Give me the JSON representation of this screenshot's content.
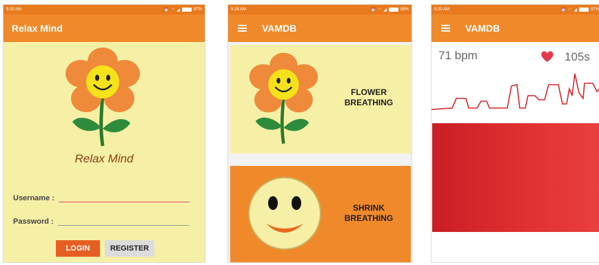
{
  "screens": [
    {
      "status_time": "9:20 AM",
      "battery": "87%",
      "app_title": "Relax Mind",
      "logo_text": "Relax Mind",
      "username_label": "Username :",
      "password_label": "Password :",
      "login_label": "LOGIN",
      "register_label": "REGISTER"
    },
    {
      "status_time": "9:28 AM",
      "battery": "89%",
      "app_title": "VAMDB",
      "cards": [
        {
          "label_line1": "FLOWER",
          "label_line2": "BREATHING"
        },
        {
          "label_line1": "SHRINK",
          "label_line2": "BREATHING"
        }
      ]
    },
    {
      "status_time": "9:20 AM",
      "battery": "87%",
      "app_title": "VAMDB",
      "heart_rate": "71 bpm",
      "timer": "105s"
    }
  ],
  "colors": {
    "status_bar": "#e87a1e",
    "app_bar": "#f0892a",
    "panel_yellow": "#f6f0a6",
    "login_button": "#e65f22",
    "waveform": "#d8262b",
    "heart": "#e23b4b"
  },
  "icons": [
    "menu-icon",
    "heart-icon",
    "flower-smiley-icon",
    "smiley-face-icon",
    "wifi-icon",
    "signal-icon",
    "battery-icon"
  ]
}
